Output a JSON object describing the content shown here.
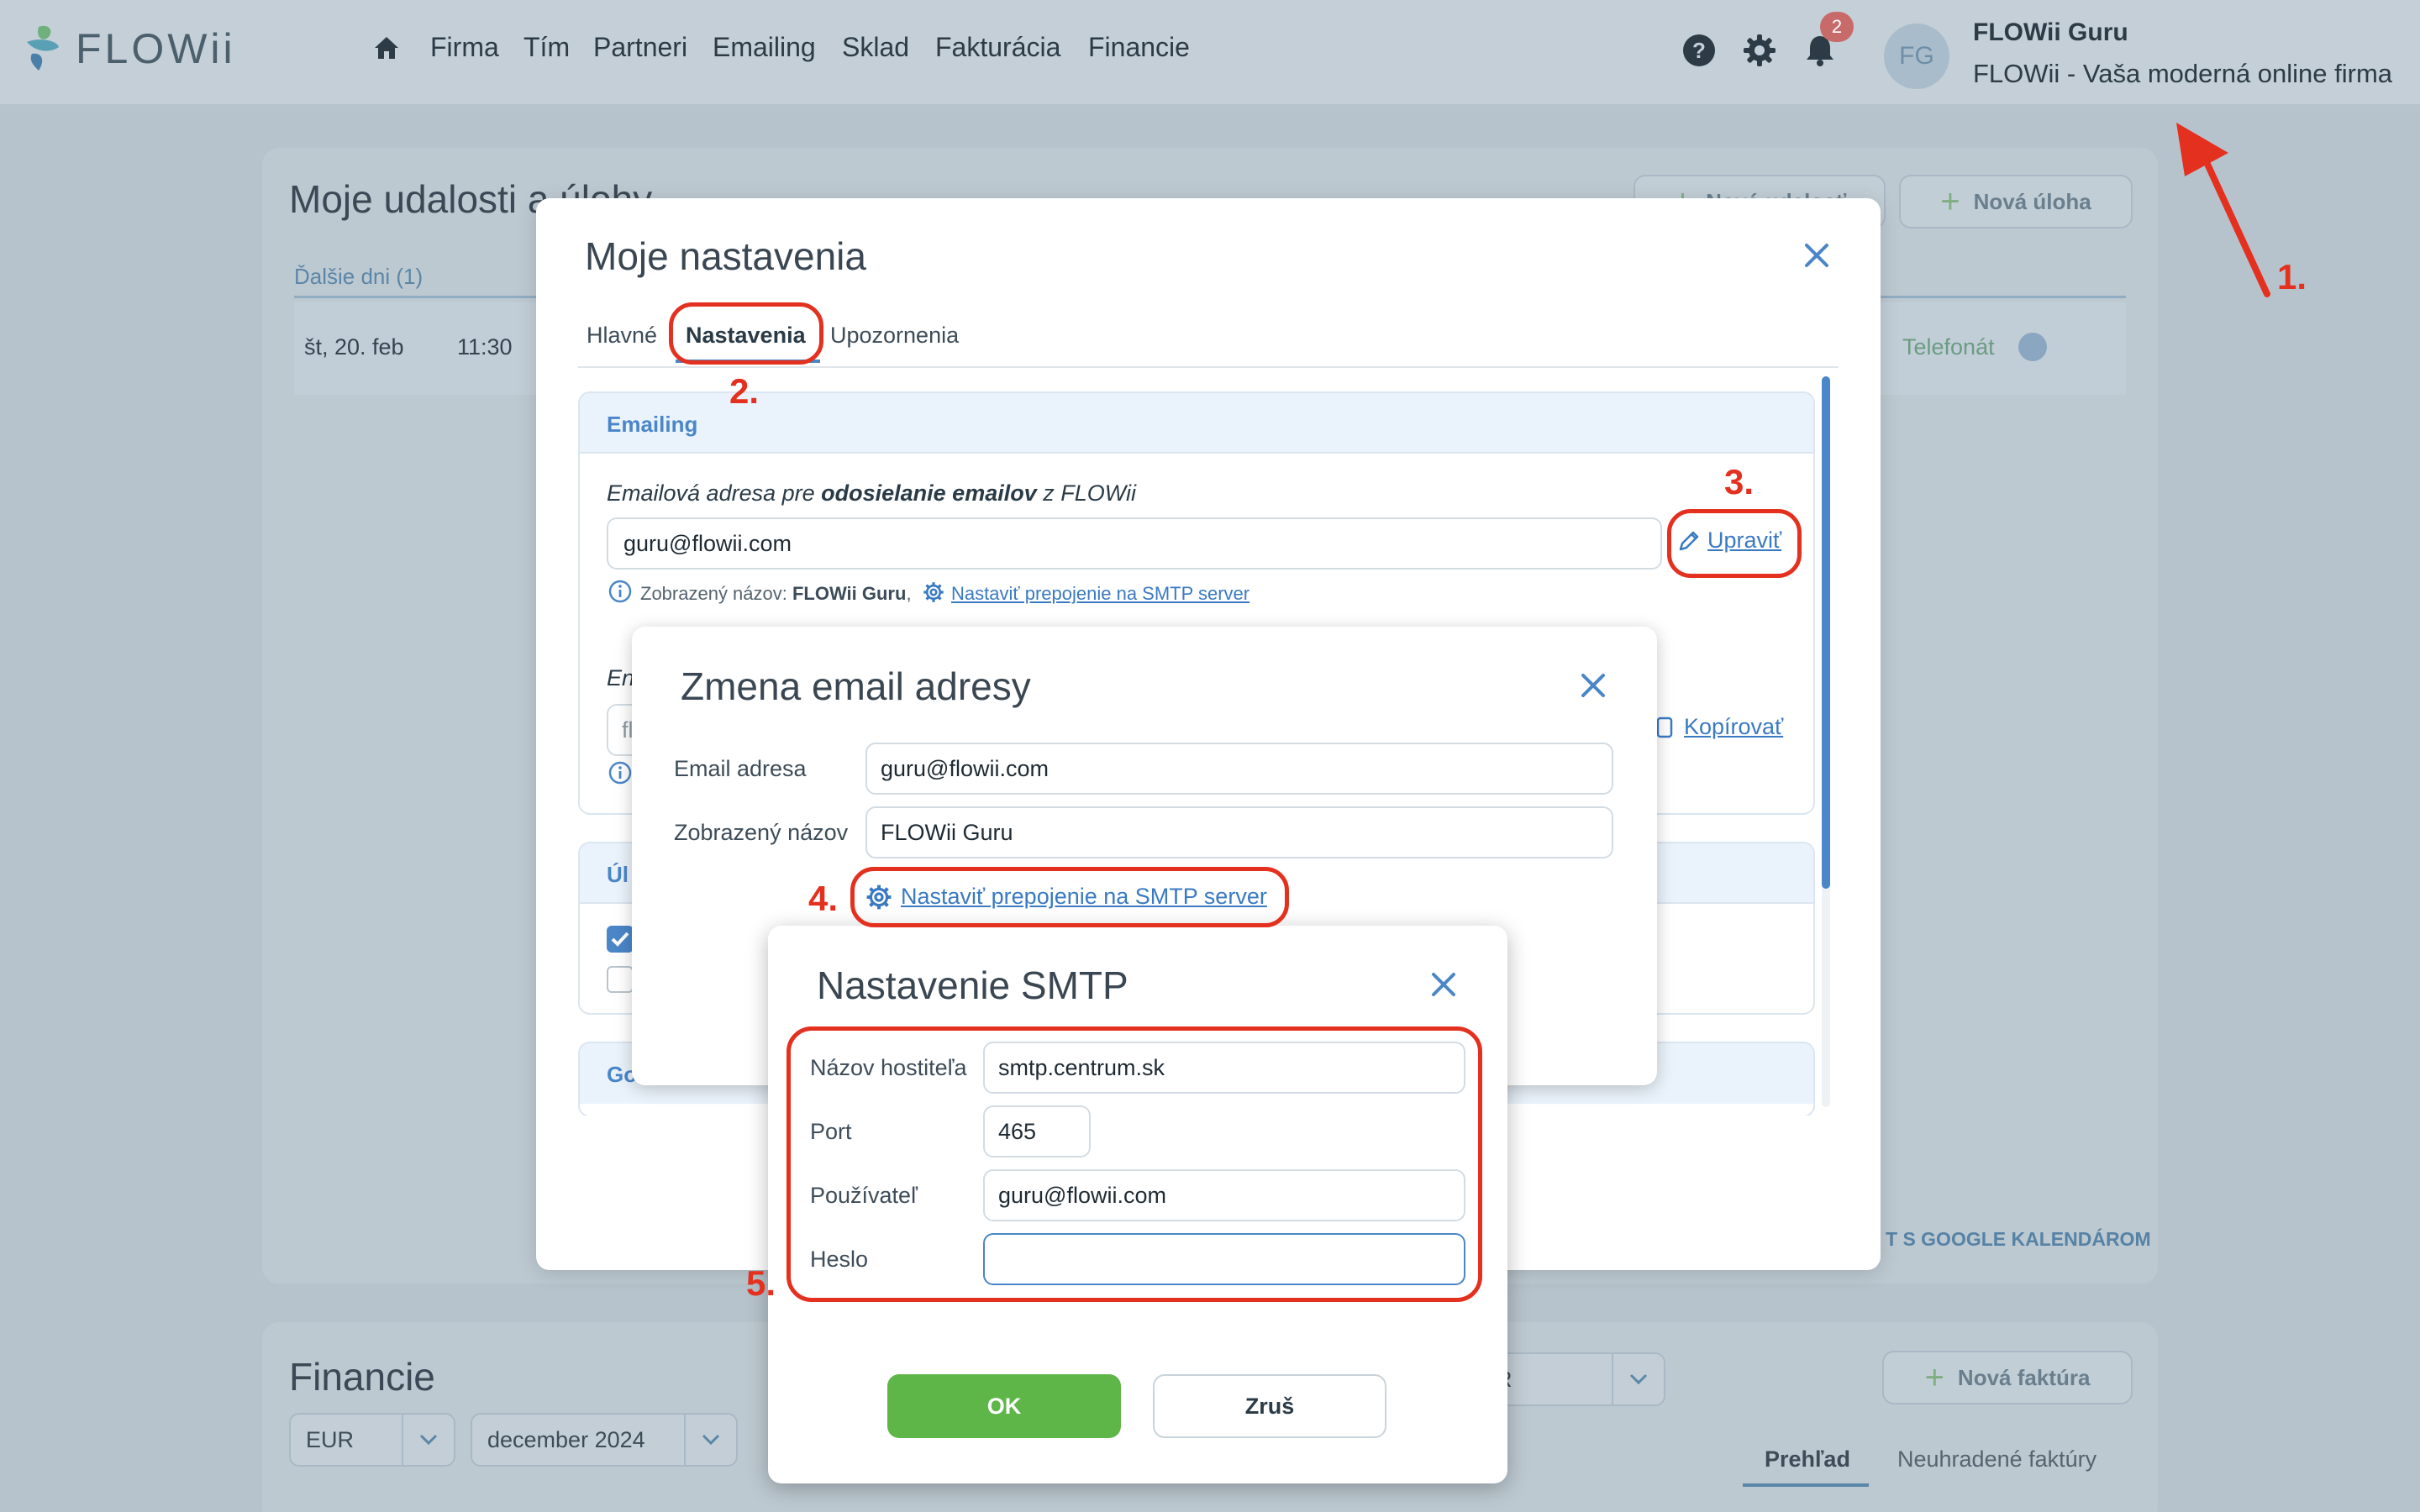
{
  "app": {
    "logo_text": "FLOWii",
    "nav": [
      "Firma",
      "Tím",
      "Partneri",
      "Emailing",
      "Sklad",
      "Fakturácia",
      "Financie"
    ],
    "notifications_count": "2",
    "avatar_initials": "FG",
    "user_name": "FLOWii Guru",
    "company_name": "FLOWii - Vaša moderná online firma"
  },
  "dashboard": {
    "tasks_title": "Moje udalosti a úlohy",
    "new_event_label": "Nová udalosť",
    "new_task_label": "Nová úloha",
    "subtab": "Ďalšie dni (1)",
    "task": {
      "date": "št, 20. feb",
      "time": "11:30",
      "type": "Telefonát"
    },
    "google_sync": "T S GOOGLE KALENDÁROM",
    "finance_title": "Financie",
    "currency": "EUR",
    "month": "december 2024",
    "right_select": "R",
    "new_invoice_label": "Nová faktúra",
    "tab_overview": "Prehľad",
    "tab_unpaid": "Neuhradené faktúry"
  },
  "settings_modal": {
    "title": "Moje nastavenia",
    "tabs": [
      "Hlavné",
      "Nastavenia",
      "Upozornenia"
    ],
    "active_tab": "Nastavenia",
    "emailing": {
      "section_title": "Emailing",
      "send_label_pre": "Emailová adresa pre ",
      "send_label_bold": "odosielanie emailov",
      "send_label_post": " z FLOWii",
      "send_address": "guru@flowii.com",
      "edit_label": "Upraviť",
      "display_name_prefix": "Zobrazený názov: ",
      "display_name_value": "FLOWii Guru",
      "display_name_sep": ",",
      "smtp_link": "Nastaviť prepojenie na SMTP server",
      "row2_label": "En",
      "row2_value": "fl",
      "copy_label": "Kopírovať"
    },
    "tasks_section_title": "Úl",
    "google_section_title": "Go"
  },
  "change_email_modal": {
    "title": "Zmena email adresy",
    "email_label": "Email adresa",
    "email_value": "guru@flowii.com",
    "name_label": "Zobrazený názov",
    "name_value": "FLOWii Guru",
    "smtp_link": "Nastaviť prepojenie na SMTP server"
  },
  "smtp_modal": {
    "title": "Nastavenie SMTP",
    "host_label": "Názov hostiteľa",
    "host_value": "smtp.centrum.sk",
    "port_label": "Port",
    "port_value": "465",
    "user_label": "Používateľ",
    "user_value": "guru@flowii.com",
    "pass_label": "Heslo",
    "pass_value": "",
    "ok_label": "OK",
    "cancel_label": "Zruš"
  },
  "annotations": {
    "step1": "1.",
    "step2": "2.",
    "step3": "3.",
    "step4": "4.",
    "step5": "5.",
    "color": "#e4301f"
  },
  "colors": {
    "accent": "#4a86c8",
    "ok_green": "#5fb648",
    "overlay": "#b7c3cc"
  }
}
